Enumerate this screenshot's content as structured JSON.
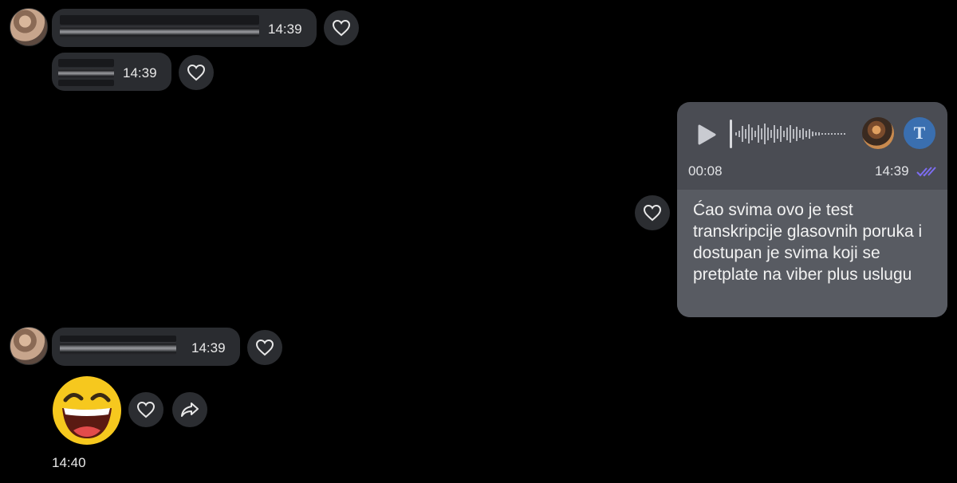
{
  "messages": {
    "m1": {
      "time": "14:39"
    },
    "m2": {
      "time": "14:39"
    },
    "m3": {
      "time": "14:39"
    },
    "emoji_msg": {
      "time": "14:40"
    }
  },
  "voice": {
    "duration": "00:08",
    "time": "14:39",
    "transcribe_label": "T",
    "transcript": "Ćao svima ovo je test transkripcije glasovnih poruka i dostupan je svima koji se pretplate na viber plus uslugu"
  },
  "colors": {
    "read_ticks": "#7d6df2",
    "transcribe_button": "#3a6fb0",
    "outgoing_bubble": "#4a4c53",
    "transcript_bg": "#585b62"
  },
  "icons": {
    "like": "heart-icon",
    "forward": "share-icon",
    "play": "play-icon",
    "read": "double-check-icon"
  }
}
